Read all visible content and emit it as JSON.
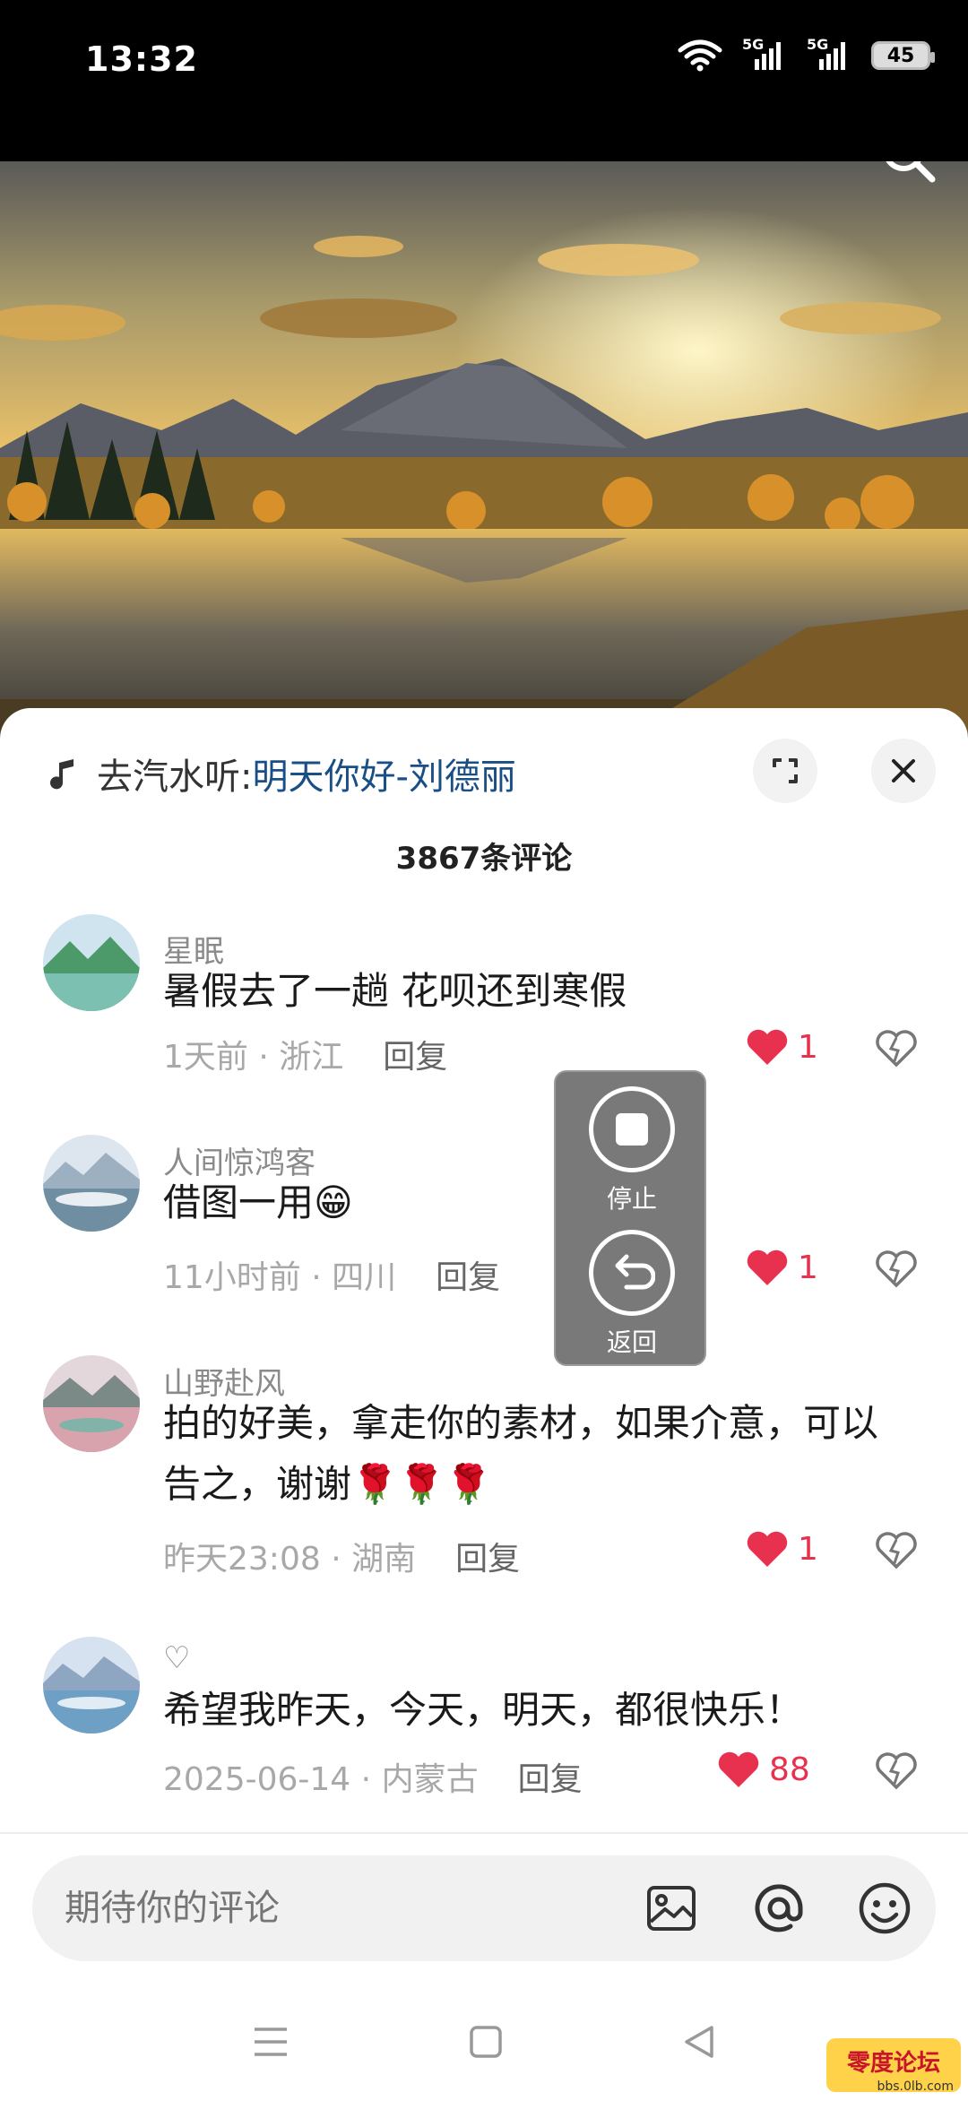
{
  "status_bar": {
    "time": "13:32",
    "network_1": "5G",
    "network_2": "5G",
    "battery": "45"
  },
  "music": {
    "prefix": "去汽水听: ",
    "song": "明天你好-刘德丽"
  },
  "comments_header": {
    "count_label": "3867条评论"
  },
  "comments": [
    {
      "user": "星眠",
      "text": "暑假去了一趟 花呗还到寒假",
      "time": "1天前",
      "location": "浙江",
      "reply": "回复",
      "likes": "1"
    },
    {
      "user": "人间惊鸿客",
      "text": "借图一用😁",
      "time": "11小时前",
      "location": "四川",
      "reply": "回复",
      "likes": "1"
    },
    {
      "user": "山野赴风",
      "text": "拍的好美，拿走你的素材，如果介意，可以告之，谢谢🌹🌹🌹",
      "time": "昨天23:08",
      "location": "湖南",
      "reply": "回复",
      "likes": "1"
    },
    {
      "user": "♡",
      "text": "希望我昨天，今天，明天，都很快乐！",
      "time": "2025-06-14",
      "location": "内蒙古",
      "reply": "回复",
      "likes": "88"
    }
  ],
  "overlay": {
    "stop_label": "停止",
    "back_label": "返回"
  },
  "input": {
    "placeholder": "期待你的评论"
  },
  "colors": {
    "like": "#e8304f",
    "music_link": "#1a4f86"
  },
  "watermark": {
    "text": "bbs.0lb.com",
    "logo_text": "零度论坛"
  }
}
